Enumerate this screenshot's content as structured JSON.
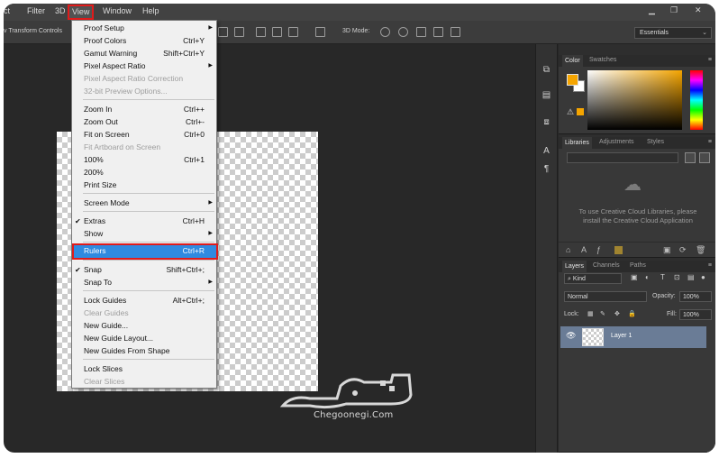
{
  "menubar": {
    "items": [
      "ct",
      "Filter",
      "3D",
      "View",
      "Window",
      "Help"
    ],
    "active_item": "View",
    "window_controls": [
      "minimize",
      "restore",
      "close"
    ]
  },
  "options_bar": {
    "transform_label": "v Transform Controls",
    "mode_label": "3D Mode:",
    "workspace": "Essentials"
  },
  "view_menu": {
    "items": [
      {
        "label": "Proof Setup",
        "shortcut": "",
        "submenu": true,
        "disabled": false,
        "checked": false
      },
      {
        "label": "Proof Colors",
        "shortcut": "Ctrl+Y",
        "submenu": false,
        "disabled": false,
        "checked": false
      },
      {
        "label": "Gamut Warning",
        "shortcut": "Shift+Ctrl+Y",
        "submenu": false,
        "disabled": false,
        "checked": false
      },
      {
        "label": "Pixel Aspect Ratio",
        "shortcut": "",
        "submenu": true,
        "disabled": false,
        "checked": false
      },
      {
        "label": "Pixel Aspect Ratio Correction",
        "shortcut": "",
        "submenu": false,
        "disabled": true,
        "checked": false
      },
      {
        "label": "32-bit Preview Options...",
        "shortcut": "",
        "submenu": false,
        "disabled": true,
        "checked": false
      },
      {
        "label": "Zoom In",
        "shortcut": "Ctrl++",
        "submenu": false,
        "disabled": false,
        "checked": false
      },
      {
        "label": "Zoom Out",
        "shortcut": "Ctrl+-",
        "submenu": false,
        "disabled": false,
        "checked": false
      },
      {
        "label": "Fit on Screen",
        "shortcut": "Ctrl+0",
        "submenu": false,
        "disabled": false,
        "checked": false
      },
      {
        "label": "Fit Artboard on Screen",
        "shortcut": "",
        "submenu": false,
        "disabled": true,
        "checked": false
      },
      {
        "label": "100%",
        "shortcut": "Ctrl+1",
        "submenu": false,
        "disabled": false,
        "checked": false
      },
      {
        "label": "200%",
        "shortcut": "",
        "submenu": false,
        "disabled": false,
        "checked": false
      },
      {
        "label": "Print Size",
        "shortcut": "",
        "submenu": false,
        "disabled": false,
        "checked": false
      },
      {
        "label": "Screen Mode",
        "shortcut": "",
        "submenu": true,
        "disabled": false,
        "checked": false
      },
      {
        "label": "Extras",
        "shortcut": "Ctrl+H",
        "submenu": false,
        "disabled": false,
        "checked": true
      },
      {
        "label": "Show",
        "shortcut": "",
        "submenu": true,
        "disabled": false,
        "checked": false
      },
      {
        "label": "Rulers",
        "shortcut": "Ctrl+R",
        "submenu": false,
        "disabled": false,
        "checked": false,
        "highlighted": true
      },
      {
        "label": "Snap",
        "shortcut": "Shift+Ctrl+;",
        "submenu": false,
        "disabled": false,
        "checked": true
      },
      {
        "label": "Snap To",
        "shortcut": "",
        "submenu": true,
        "disabled": false,
        "checked": false
      },
      {
        "label": "Lock Guides",
        "shortcut": "Alt+Ctrl+;",
        "submenu": false,
        "disabled": false,
        "checked": false
      },
      {
        "label": "Clear Guides",
        "shortcut": "",
        "submenu": false,
        "disabled": true,
        "checked": false
      },
      {
        "label": "New Guide...",
        "shortcut": "",
        "submenu": false,
        "disabled": false,
        "checked": false
      },
      {
        "label": "New Guide Layout...",
        "shortcut": "",
        "submenu": false,
        "disabled": false,
        "checked": false
      },
      {
        "label": "New Guides From Shape",
        "shortcut": "",
        "submenu": false,
        "disabled": false,
        "checked": false
      },
      {
        "label": "Lock Slices",
        "shortcut": "",
        "submenu": false,
        "disabled": false,
        "checked": false
      },
      {
        "label": "Clear Slices",
        "shortcut": "",
        "submenu": false,
        "disabled": true,
        "checked": false
      }
    ]
  },
  "color_panel": {
    "tabs": [
      "Color",
      "Swatches"
    ],
    "active_tab": "Color",
    "foreground": "#f5a500",
    "background": "#ffffff"
  },
  "libraries_panel": {
    "tabs": [
      "Libraries",
      "Adjustments",
      "Styles"
    ],
    "active_tab": "Libraries",
    "message": "To use Creative Cloud Libraries, please install the Creative Cloud Application"
  },
  "layers_panel": {
    "tabs": [
      "Layers",
      "Channels",
      "Paths"
    ],
    "active_tab": "Layers",
    "filter": "Kind",
    "blend_mode": "Normal",
    "opacity_label": "Opacity:",
    "opacity": "100%",
    "lock_label": "Lock:",
    "fill_label": "Fill:",
    "fill": "100%",
    "layers": [
      {
        "name": "Layer 1",
        "visible": true
      }
    ]
  },
  "watermark": {
    "site": "Chegoonegi.Com"
  }
}
